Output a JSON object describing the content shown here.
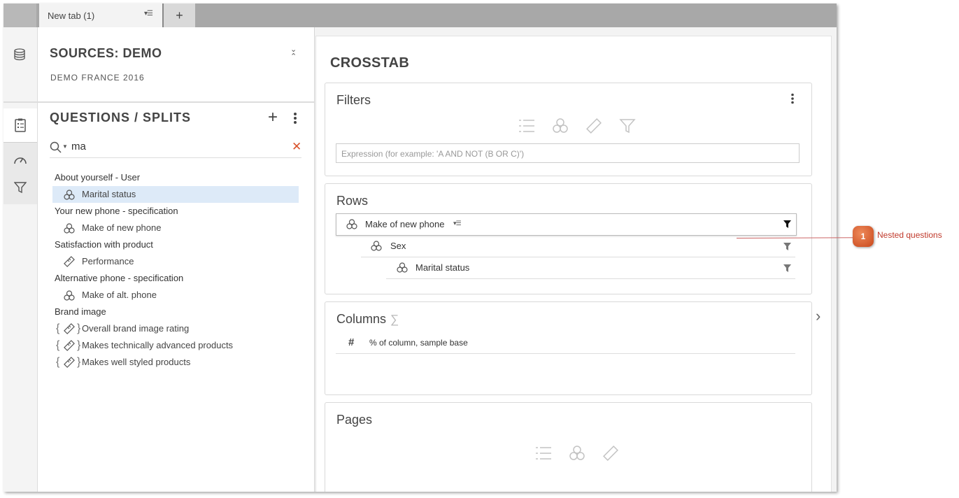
{
  "tabs": {
    "active_label": "New tab (1)",
    "menu_glyph": "▾☰",
    "add_label": "+"
  },
  "sources": {
    "title": "SOURCES: DEMO",
    "subtitle": "DEMO FRANCE 2016"
  },
  "questions": {
    "title": "QUESTIONS / SPLITS",
    "add_label": "+",
    "search_value": "ma",
    "clear_label": "✕",
    "groups": [
      {
        "label": "About yourself - User",
        "items": [
          {
            "label": "Marital status",
            "icon": "split-icon",
            "selected": true
          }
        ]
      },
      {
        "label": "Your new phone - specification",
        "items": [
          {
            "label": "Make of new phone",
            "icon": "split-icon"
          }
        ]
      },
      {
        "label": "Satisfaction with product",
        "items": [
          {
            "label": "Performance",
            "icon": "ruler-icon"
          }
        ]
      },
      {
        "label": "Alternative phone - specification",
        "items": [
          {
            "label": "Make of alt. phone",
            "icon": "split-icon"
          }
        ]
      },
      {
        "label": "Brand image",
        "items": [
          {
            "label": "Overall brand image rating",
            "icon": "ruler-brace-icon"
          },
          {
            "label": "Makes technically advanced products",
            "icon": "ruler-brace-icon"
          },
          {
            "label": "Makes well styled products",
            "icon": "ruler-brace-icon"
          }
        ]
      }
    ]
  },
  "crosstab": {
    "title": "CROSSTAB",
    "filters": {
      "title": "Filters",
      "placeholder": "Expression (for example: 'A AND NOT (B OR C)')"
    },
    "rows": {
      "title": "Rows",
      "items": [
        "Make of new phone",
        "Sex",
        "Marital status"
      ],
      "menu_glyph": "▾☰"
    },
    "columns": {
      "title": "Columns",
      "sigma": "∑",
      "hash": "#",
      "item": "% of column, sample base"
    },
    "pages": {
      "title": "Pages"
    }
  },
  "callout": {
    "number": "1",
    "text": "Nested questions",
    "color": "#c0392b"
  }
}
